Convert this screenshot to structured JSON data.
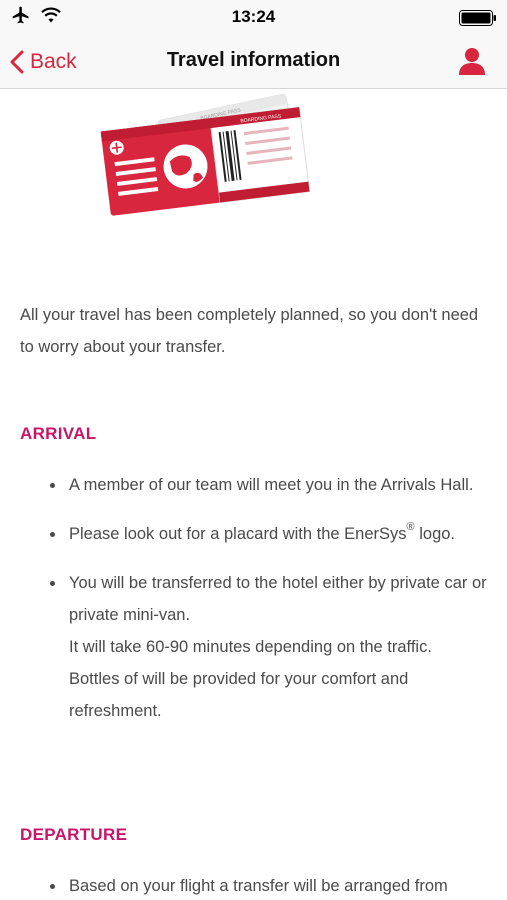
{
  "status_bar": {
    "time": "13:24"
  },
  "nav": {
    "back_label": "Back",
    "title": "Travel information"
  },
  "intro": "All your travel has been completely planned, so you don't need to worry about your transfer.",
  "arrival": {
    "heading": "ARRIVAL",
    "items": [
      "A member of our team will meet you in the Arrivals Hall.",
      {
        "before": "Please look out for a placard with the EnerSys",
        "sup": "®",
        "after": " logo."
      },
      {
        "line1": "You will be transferred to the hotel either by private car or private mini-van.",
        "line2": "It will take 60-90 minutes depending on the traffic.",
        "line3": "Bottles of will be provided for your comfort and refreshment."
      }
    ]
  },
  "departure": {
    "heading": "DEPARTURE",
    "items": [
      "Based on your flight a transfer will be arranged from"
    ]
  },
  "illustration": {
    "ticket_label": "BOARDING PASS",
    "colors": {
      "red": "#d7263d",
      "magenta": "#c8146a"
    }
  }
}
